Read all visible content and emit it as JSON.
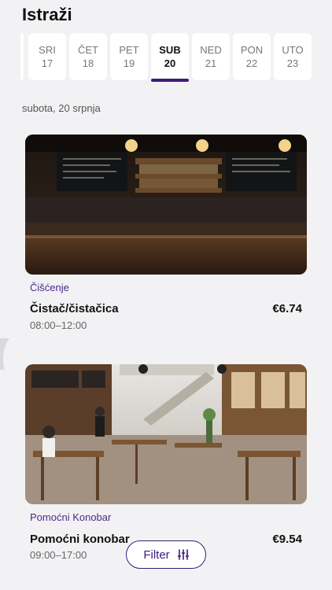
{
  "header": {
    "title": "Istraži"
  },
  "days": [
    {
      "name": "SRI",
      "num": "17",
      "active": false
    },
    {
      "name": "ČET",
      "num": "18",
      "active": false
    },
    {
      "name": "PET",
      "num": "19",
      "active": false
    },
    {
      "name": "SUB",
      "num": "20",
      "active": true
    },
    {
      "name": "NED",
      "num": "21",
      "active": false
    },
    {
      "name": "PON",
      "num": "22",
      "active": false
    },
    {
      "name": "UTO",
      "num": "23",
      "active": false
    }
  ],
  "selected_date": "subota, 20 srpnja",
  "jobs": [
    {
      "category": "Čišćenje",
      "title": "Čistač/čistačica",
      "price": "€6.74",
      "time": "08:00–12:00",
      "image": "bar-interior-photo"
    },
    {
      "category": "Pomoćni Konobar",
      "title": "Pomoćni konobar",
      "price": "€9.54",
      "time": "09:00–17:00",
      "image": "restaurant-interior-photo"
    }
  ],
  "filter": {
    "label": "Filter",
    "icon": "sliders-icon"
  },
  "colors": {
    "accent": "#3b1b7a",
    "category": "#4a2a8a",
    "background": "#f2f2f4"
  }
}
